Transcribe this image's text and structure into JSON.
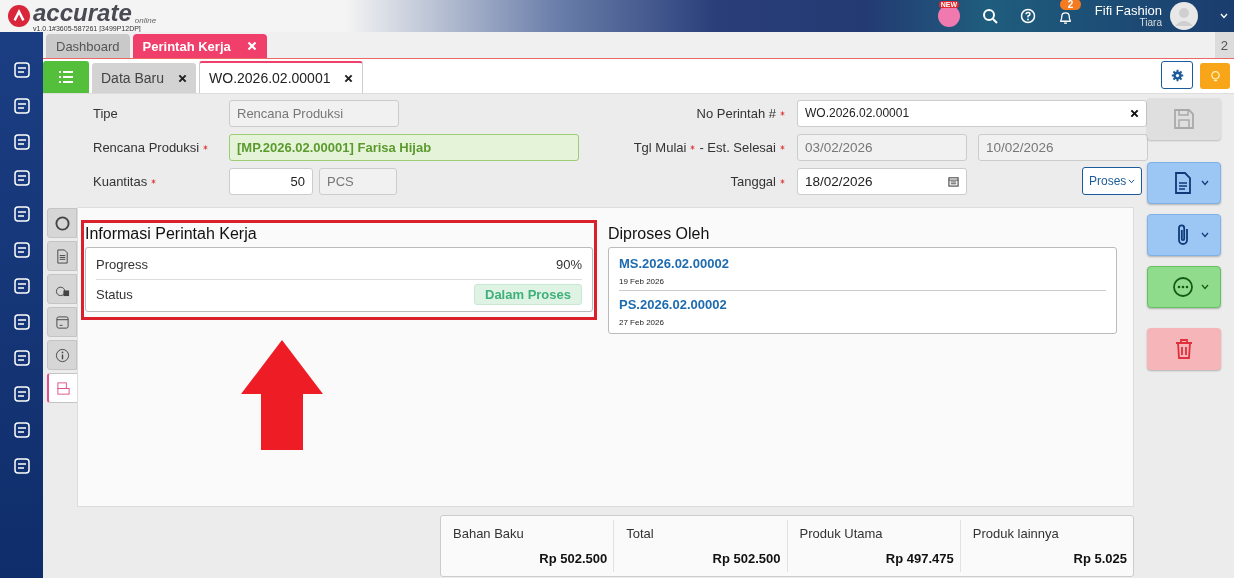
{
  "header": {
    "logo_text": "accurate",
    "logo_sub": "online",
    "version": "v1.0.1#3605-587261 [3499P12DP]",
    "new_badge": "NEW",
    "notification_count": "2",
    "company": "Fifi Fashion",
    "user": "Tiara"
  },
  "main_tabs": [
    {
      "label": "Dashboard",
      "selected": false,
      "closable": false
    },
    {
      "label": "Perintah Kerja",
      "selected": true,
      "closable": true
    }
  ],
  "tab_count": "2",
  "sub_tabs": [
    {
      "label": "Data Baru",
      "selected": false
    },
    {
      "label": "WO.2026.02.00001",
      "selected": true
    }
  ],
  "form_left": [
    {
      "label": "Tipe",
      "required": false,
      "kind": "readonly",
      "value": "Rencana Produksi"
    },
    {
      "label": "Rencana Produksi",
      "required": true,
      "kind": "lookup",
      "value": "[MP.2026.02.00001] Farisa Hijab"
    },
    {
      "label": "Kuantitas",
      "required": true,
      "kind": "quantity",
      "value": "50",
      "unit": "PCS"
    }
  ],
  "form_right": [
    {
      "kind": "clearable",
      "labels": [
        {
          "text": "No Perintah #",
          "required": true
        }
      ],
      "values": [
        {
          "value": "WO.2026.02.00001",
          "disabled": false
        }
      ]
    },
    {
      "kind": "range",
      "labels": [
        {
          "text": "Tgl Mulai",
          "required": true
        },
        {
          "text": "- Est. Selesai",
          "required": true
        }
      ],
      "values": [
        {
          "value": "03/02/2026",
          "disabled": true
        },
        {
          "value": "10/02/2026",
          "disabled": true
        }
      ]
    },
    {
      "kind": "date",
      "labels": [
        {
          "text": "Tanggal",
          "required": true
        }
      ],
      "values": [
        {
          "value": "18/02/2026",
          "disabled": false
        }
      ]
    }
  ],
  "proses_button": "Proses",
  "side_tabs": [
    {
      "kind": "circle",
      "selected": false
    },
    {
      "kind": "document",
      "selected": false
    },
    {
      "kind": "money",
      "selected": false
    },
    {
      "kind": "box",
      "selected": false
    },
    {
      "kind": "info",
      "selected": false
    },
    {
      "kind": "stack",
      "selected": true
    }
  ],
  "info_panel": {
    "title": "Informasi Perintah Kerja",
    "rows": [
      {
        "label": "Progress",
        "kind": "text",
        "value": "90%"
      },
      {
        "label": "Status",
        "kind": "badge",
        "value": "Dalam Proses"
      }
    ]
  },
  "processed_by": {
    "title": "Diproses Oleh",
    "items": [
      {
        "number": "MS.2026.02.00002",
        "date": "19 Feb 2026"
      },
      {
        "number": "PS.2026.02.00002",
        "date": "27 Feb 2026"
      }
    ]
  },
  "summary": [
    {
      "label": "Bahan Baku",
      "value": "Rp 502.500"
    },
    {
      "label": "Total",
      "value": "Rp 502.500"
    },
    {
      "label": "Produk Utama",
      "value": "Rp 497.475"
    },
    {
      "label": "Produk lainnya",
      "value": "Rp 5.025"
    }
  ],
  "actions": [
    {
      "kind": "save",
      "disabled": true,
      "dropdown": false
    },
    {
      "kind": "document",
      "disabled": false,
      "dropdown": true
    },
    {
      "kind": "attachment",
      "disabled": false,
      "dropdown": true
    },
    {
      "kind": "more",
      "disabled": false,
      "dropdown": true
    },
    {
      "kind": "delete",
      "disabled": false,
      "dropdown": false
    }
  ]
}
